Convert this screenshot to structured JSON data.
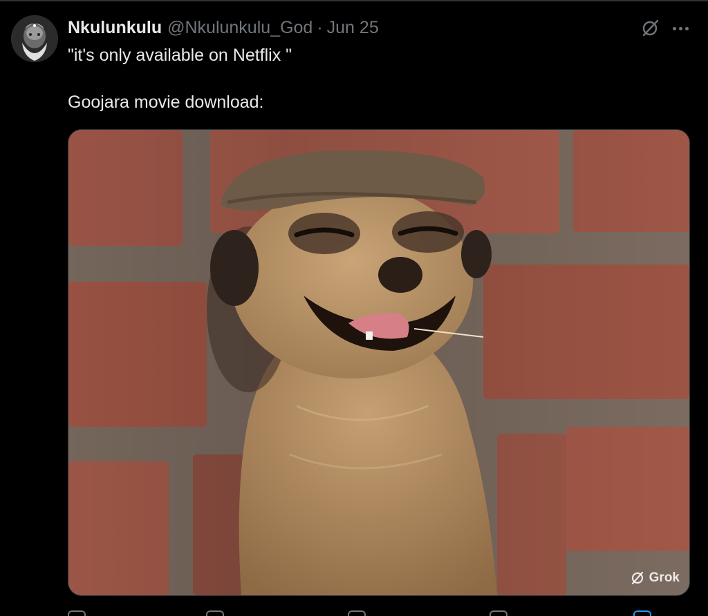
{
  "tweet": {
    "author_name": "Nkulunkulu",
    "handle": "@Nkulunkulu_God",
    "separator": "·",
    "date": "Jun 25",
    "text_line1": "\"it's only available on Netflix \"",
    "text_line2": "Goojara movie download:",
    "media": {
      "description_icon": "meerkat-photo",
      "watermark": "Grok"
    }
  },
  "icons": {
    "grok": "grok-icon",
    "more": "more-options-icon"
  },
  "colors": {
    "background": "#000000",
    "primary_text": "#e7e9ea",
    "secondary_text": "#71767b"
  }
}
